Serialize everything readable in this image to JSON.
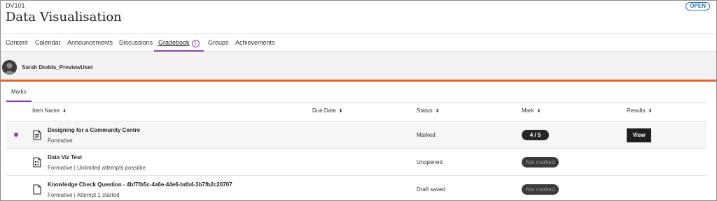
{
  "course": {
    "code": "DV101",
    "title": "Data Visualisation",
    "status_badge": "OPEN"
  },
  "nav": {
    "tabs": [
      {
        "label": "Content"
      },
      {
        "label": "Calendar"
      },
      {
        "label": "Announcements"
      },
      {
        "label": "Discussions"
      },
      {
        "label": "Gradebook",
        "badge": "1",
        "active": true
      },
      {
        "label": "Groups"
      },
      {
        "label": "Achievements"
      }
    ]
  },
  "user": {
    "name": "Sarah Dodds_PreviewUser"
  },
  "subtabs": [
    {
      "label": "Marks",
      "active": true
    }
  ],
  "table": {
    "columns": [
      {
        "label": "Item Name"
      },
      {
        "label": "Due Date"
      },
      {
        "label": "Status"
      },
      {
        "label": "Mark"
      },
      {
        "label": "Results"
      }
    ],
    "rows": [
      {
        "title": "Designing for a Community Centre",
        "subtitle": "Formative",
        "due": "",
        "status": "Marked",
        "mark": "4 / 5",
        "results_button": "View",
        "new_indicator": true,
        "icon": "document-icon"
      },
      {
        "title": "Data Viz Test",
        "subtitle": "Formative | Unlimited attempts possible",
        "due": "",
        "status": "Unopened",
        "mark": "Not marked",
        "icon": "test-document-icon"
      },
      {
        "title": "Knowledge Check Question - 4bf7fb5c-4a6e-44e6-bdb4-3b7fb2c20707",
        "subtitle": "Formative | Attempt 1 started",
        "due": "",
        "status": "Draft saved",
        "mark": "Not marked",
        "icon": "blank-document-icon"
      }
    ]
  },
  "colors": {
    "accent_purple": "#8f3fa8",
    "divider_orange": "#e8632b",
    "open_blue": "#2a6fb0"
  }
}
